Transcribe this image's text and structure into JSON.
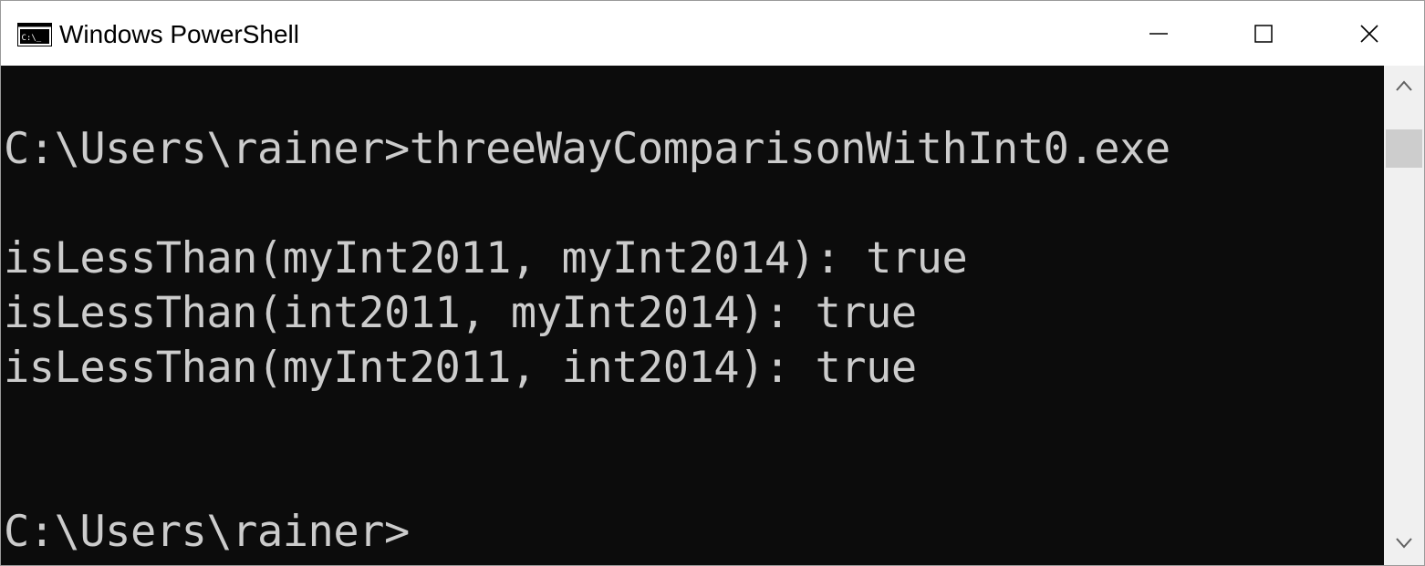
{
  "window": {
    "title": "Windows PowerShell",
    "icon": "powershell-console-icon",
    "controls": [
      "minimize-icon",
      "maximize-icon",
      "close-icon"
    ]
  },
  "console": {
    "colors": {
      "background": "#0c0c0c",
      "foreground": "#cccccc"
    },
    "lines": [
      "C:\\Users\\rainer>threeWayComparisonWithInt0.exe",
      "",
      "isLessThan(myInt2011, myInt2014): true",
      "isLessThan(int2011, myInt2014): true",
      "isLessThan(myInt2011, int2014): true",
      "",
      "",
      "C:\\Users\\rainer>"
    ]
  },
  "scrollbar": {
    "icons": [
      "chevron-up-icon",
      "chevron-down-icon"
    ]
  }
}
